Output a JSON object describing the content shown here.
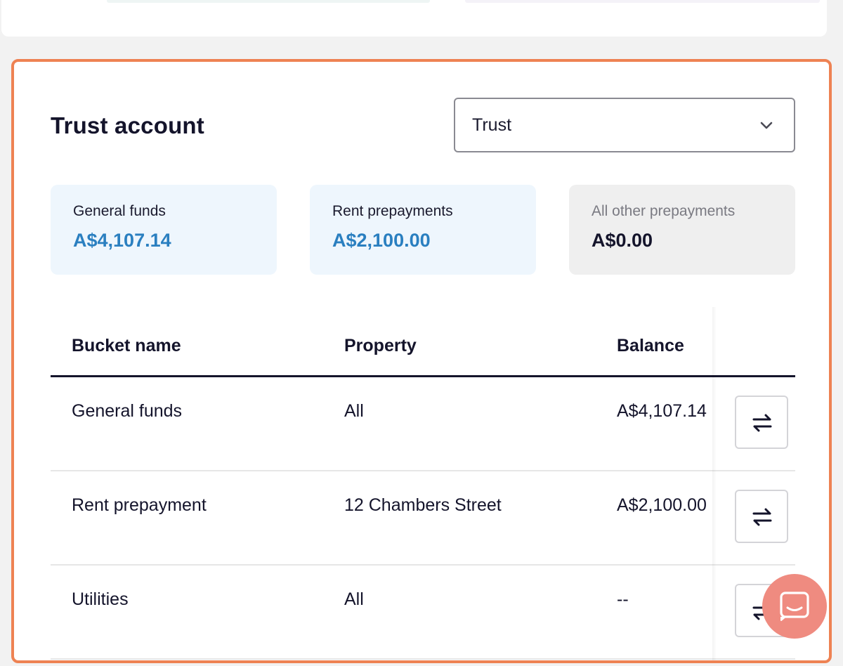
{
  "trust": {
    "title": "Trust account",
    "account_select": {
      "selected": "Trust"
    },
    "summary": [
      {
        "label": "General funds",
        "amount": "A$4,107.14"
      },
      {
        "label": "Rent prepayments",
        "amount": "A$2,100.00"
      },
      {
        "label": "All other prepayments",
        "amount": "A$0.00"
      }
    ],
    "table": {
      "headers": {
        "bucket": "Bucket name",
        "property": "Property",
        "balance": "Balance"
      },
      "rows": [
        {
          "bucket": "General funds",
          "property": "All",
          "balance": "A$4,107.14"
        },
        {
          "bucket": "Rent prepayment",
          "property": "12 Chambers Street",
          "balance": "A$2,100.00"
        },
        {
          "bucket": "Utilities",
          "property": "All",
          "balance": "--"
        }
      ]
    }
  },
  "icons": {
    "select_chevron": "chevron-down-icon",
    "transfer": "transfer-arrows-icon",
    "chat": "chat-icon"
  },
  "colors": {
    "panel_border": "#ee8253",
    "accent_blue": "#2a7fc0",
    "card_blue_bg": "#eef6fd",
    "card_grey_bg": "#efefef",
    "chat_button": "#ef8b80"
  }
}
